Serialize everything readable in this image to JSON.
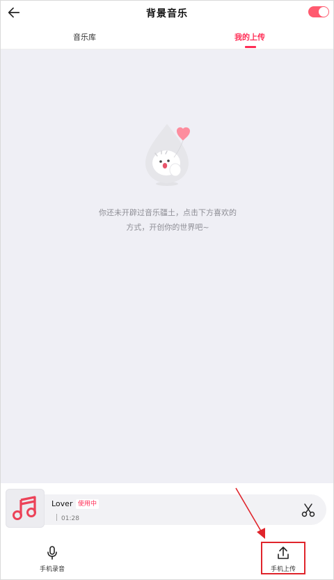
{
  "header": {
    "title": "背景音乐",
    "back_icon": "arrow-left-icon",
    "toggle_on": true
  },
  "tabs": [
    {
      "label": "音乐库",
      "active": false
    },
    {
      "label": "我的上传",
      "active": true
    }
  ],
  "empty_state": {
    "line1": "你还未开辟过音乐疆土，点击下方喜欢的",
    "line2": "方式，开创你的世界吧~",
    "illustration": "bird-holding-heart-balloon"
  },
  "now_playing": {
    "name": "Lover",
    "badge": "使用中",
    "duration": "01:28",
    "thumb_icon": "music-note-icon",
    "action_icon": "scissors-icon"
  },
  "bottom_actions": [
    {
      "label": "手机录音",
      "icon": "microphone-icon"
    },
    {
      "label": "手机上传",
      "icon": "upload-icon"
    }
  ],
  "colors": {
    "accent": "#ff2d55",
    "content_bg": "#efeff5",
    "annotation": "#e0242b"
  }
}
